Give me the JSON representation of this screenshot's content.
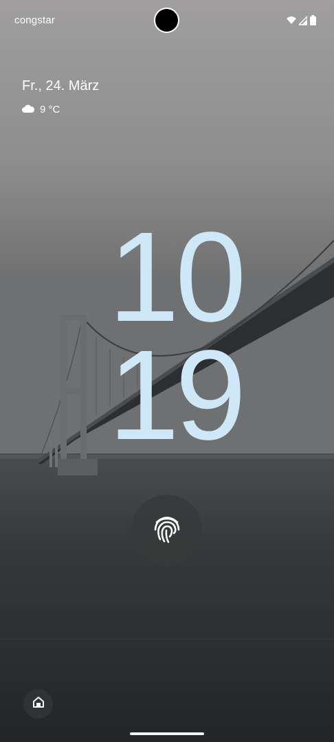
{
  "status_bar": {
    "carrier": "congstar",
    "icons": [
      "wifi-icon",
      "cellular-signal-icon",
      "battery-icon"
    ]
  },
  "lockscreen": {
    "date": "Fr., 24. März",
    "weather": {
      "icon": "cloud-icon",
      "temperature": "9 °C"
    },
    "clock": {
      "hours": "10",
      "minutes": "19"
    },
    "fingerprint_icon": "fingerprint-icon",
    "shortcut_icon": "home-icon"
  },
  "colors": {
    "clock": "#cfe8f8",
    "sky": "#9c9a9b",
    "water": "#2a2f31"
  }
}
